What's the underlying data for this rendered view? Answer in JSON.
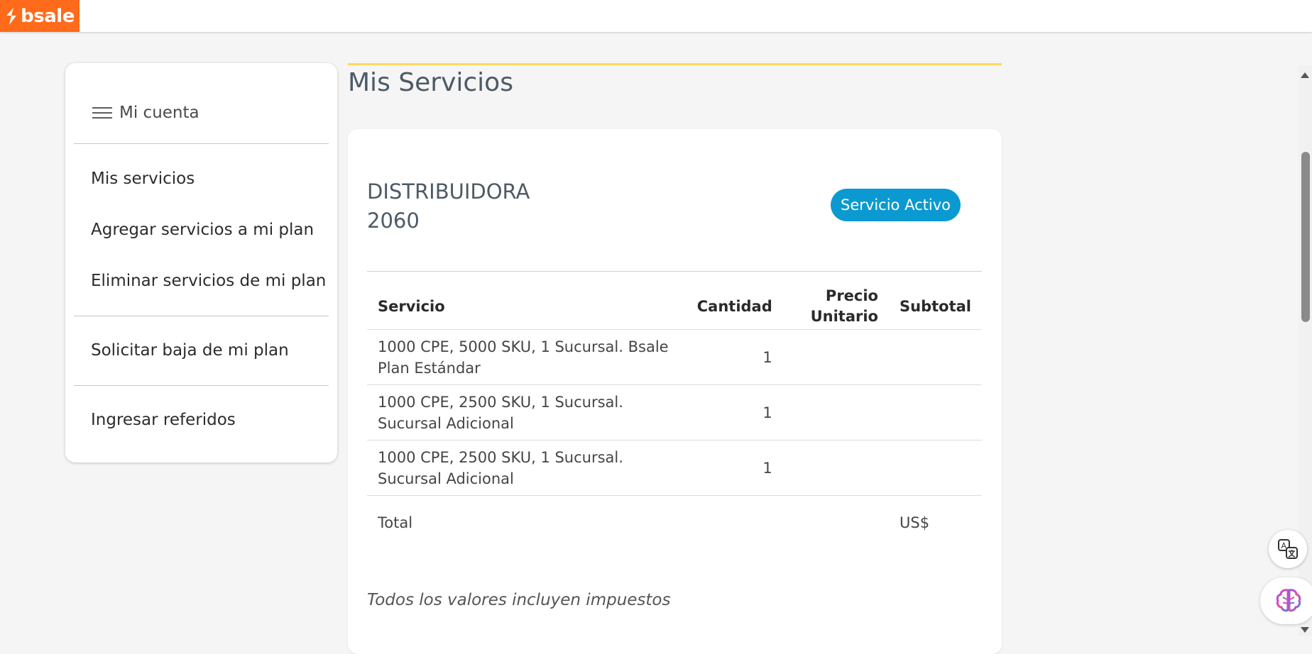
{
  "brand": {
    "logo_text": "bsale",
    "color": "#ff6b1a"
  },
  "sidebar": {
    "header": "Mi cuenta",
    "items": [
      {
        "label": "Mis servicios"
      },
      {
        "label": "Agregar servicios a mi plan"
      },
      {
        "label": "Eliminar servicios de mi plan"
      },
      {
        "label": "Solicitar baja de mi plan"
      },
      {
        "label": "Ingresar referidos"
      }
    ]
  },
  "page": {
    "title": "Mis Servicios"
  },
  "card": {
    "company_line1": "DISTRIBUIDORA",
    "company_line2": "2060",
    "status_badge": "Servicio Activo",
    "status_color": "#0a9ad1",
    "table": {
      "headers": {
        "service": "Servicio",
        "quantity": "Cantidad",
        "unit_price_line1": "Precio",
        "unit_price_line2": "Unitario",
        "subtotal": "Subtotal"
      },
      "rows": [
        {
          "service": "1000 CPE, 5000 SKU, 1 Sucursal. Bsale Plan Estándar",
          "quantity": "1",
          "unit_price": "",
          "subtotal": ""
        },
        {
          "service": "1000 CPE, 2500 SKU, 1 Sucursal. Sucursal Adicional",
          "quantity": "1",
          "unit_price": "",
          "subtotal": ""
        },
        {
          "service": "1000 CPE, 2500 SKU, 1 Sucursal. Sucursal Adicional",
          "quantity": "1",
          "unit_price": "",
          "subtotal": ""
        }
      ],
      "total_label": "Total",
      "total_value": "US$"
    },
    "footnote": "Todos los valores incluyen impuestos"
  },
  "widgets": {
    "translate": "translate-icon",
    "assistant": "brain-icon"
  }
}
